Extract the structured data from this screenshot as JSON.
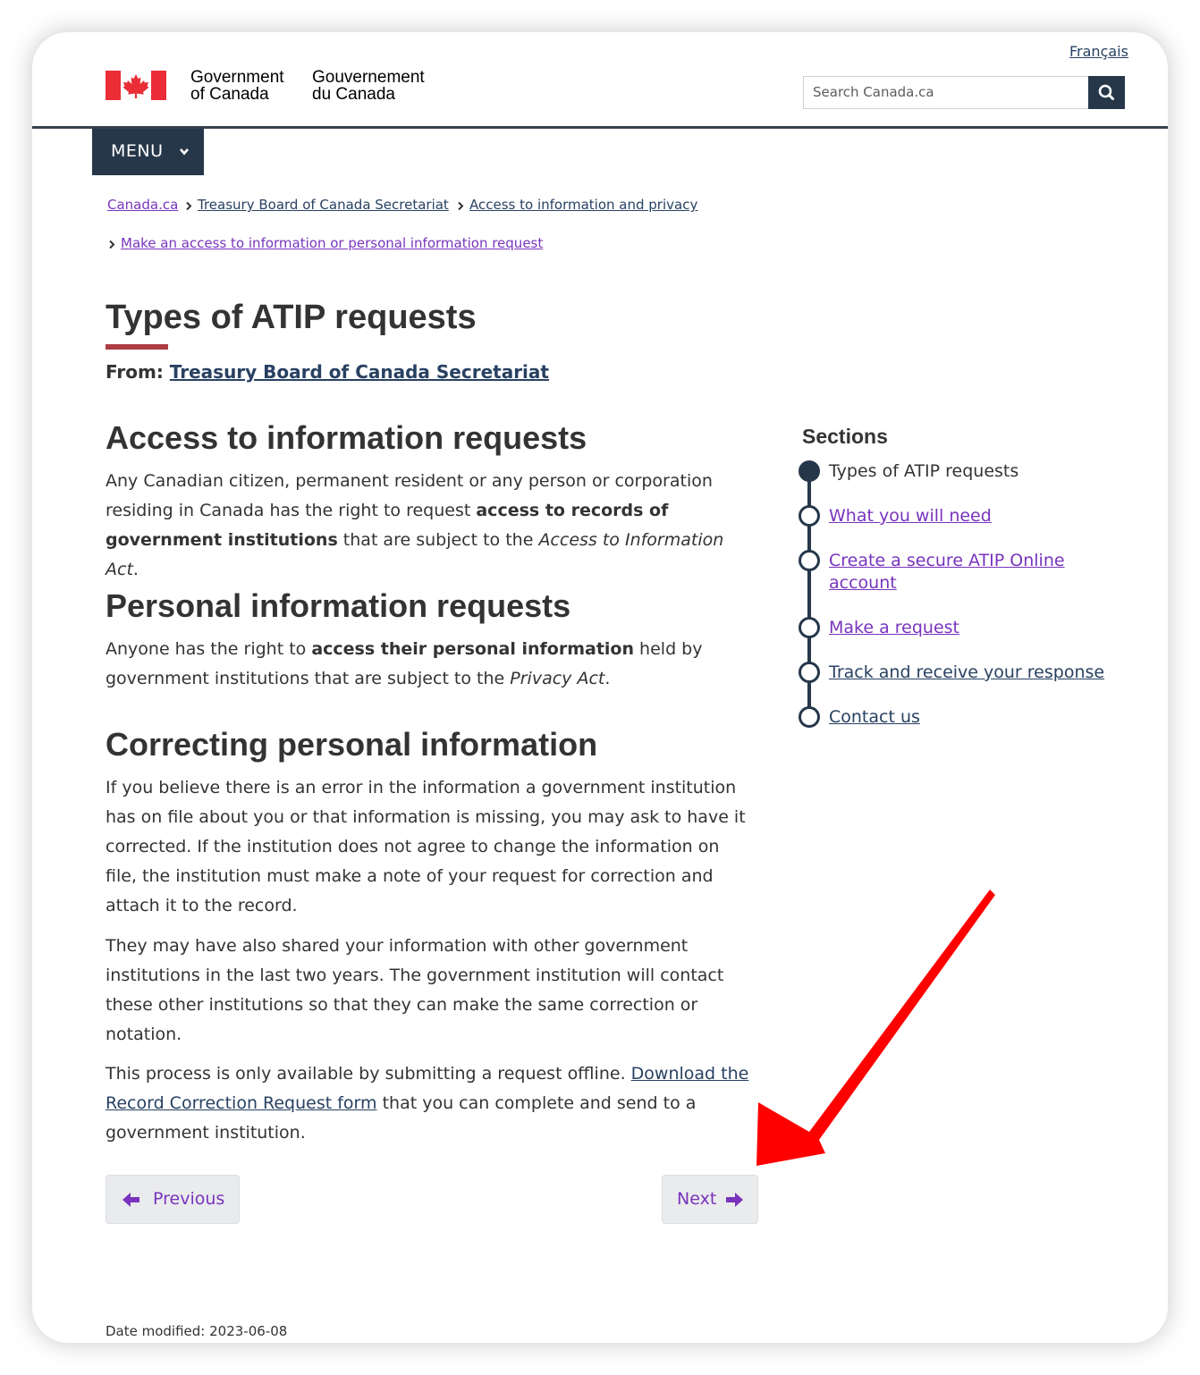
{
  "header": {
    "language_link": "Français",
    "wordmark_en": [
      "Government",
      "of Canada"
    ],
    "wordmark_fr": [
      "Gouvernement",
      "du Canada"
    ],
    "search_placeholder": "Search Canada.ca",
    "search_icon": "search-icon",
    "menu_label": "MENU",
    "brand_colors": {
      "flag_red": "#ea2d37",
      "nav_dark": "#26374a",
      "accent_red": "#af3c43"
    }
  },
  "breadcrumb": [
    {
      "label": "Canada.ca",
      "visited": true
    },
    {
      "label": "Treasury Board of Canada Secretariat",
      "visited": false
    },
    {
      "label": "Access to information and privacy",
      "visited": false
    },
    {
      "label": "Make an access to information or personal information request",
      "visited": true
    }
  ],
  "page": {
    "title": "Types of ATIP requests",
    "from_label": "From:",
    "from_link": "Treasury Board of Canada Secretariat"
  },
  "sections_content": {
    "s1": {
      "heading": "Access to information requests",
      "p1_a": "Any Canadian citizen, permanent resident or any person or corporation residing in Canada has the right to request ",
      "p1_b": "access to records of government institutions",
      "p1_c": " that are subject to the ",
      "p1_d": "Access to Information Act",
      "p1_e": "."
    },
    "s2": {
      "heading": "Personal information requests",
      "p1_a": "Anyone has the right to ",
      "p1_b": "access their personal information",
      "p1_c": " held by government institutions that are subject to the ",
      "p1_d": "Privacy Act",
      "p1_e": "."
    },
    "s3": {
      "heading": "Correcting personal information",
      "p1": "If you believe there is an error in the information a government institution has on file about you or that information is missing, you may ask to have it corrected. If the institution does not agree to change the information on file, the institution must make a note of your request for correction and attach it to the record.",
      "p2": "They may have also shared your information with other government institutions in the last two years. The government institution will contact these other institutions so that they can make the same correction or notation.",
      "p3_a": "This process is only available by submitting a request offline. ",
      "p3_link": "Download the Record Correction Request form",
      "p3_c": " that you can complete and send to a government institution."
    }
  },
  "sections_nav": {
    "title": "Sections",
    "items": [
      {
        "label": "Types of ATIP requests",
        "active": true
      },
      {
        "label": "What you will need",
        "active": false
      },
      {
        "label": "Create a secure ATIP Online account",
        "active": false
      },
      {
        "label": "Make a request",
        "active": false
      },
      {
        "label": "Track and receive your response",
        "active": false
      },
      {
        "label": "Contact us",
        "active": false
      }
    ]
  },
  "pager": {
    "previous_label": "Previous",
    "next_label": "Next"
  },
  "footer": {
    "date_modified": "Date modified: 2023-06-08"
  },
  "annotation": {
    "arrow_color": "#ff0000",
    "arrow_target": "Next"
  }
}
